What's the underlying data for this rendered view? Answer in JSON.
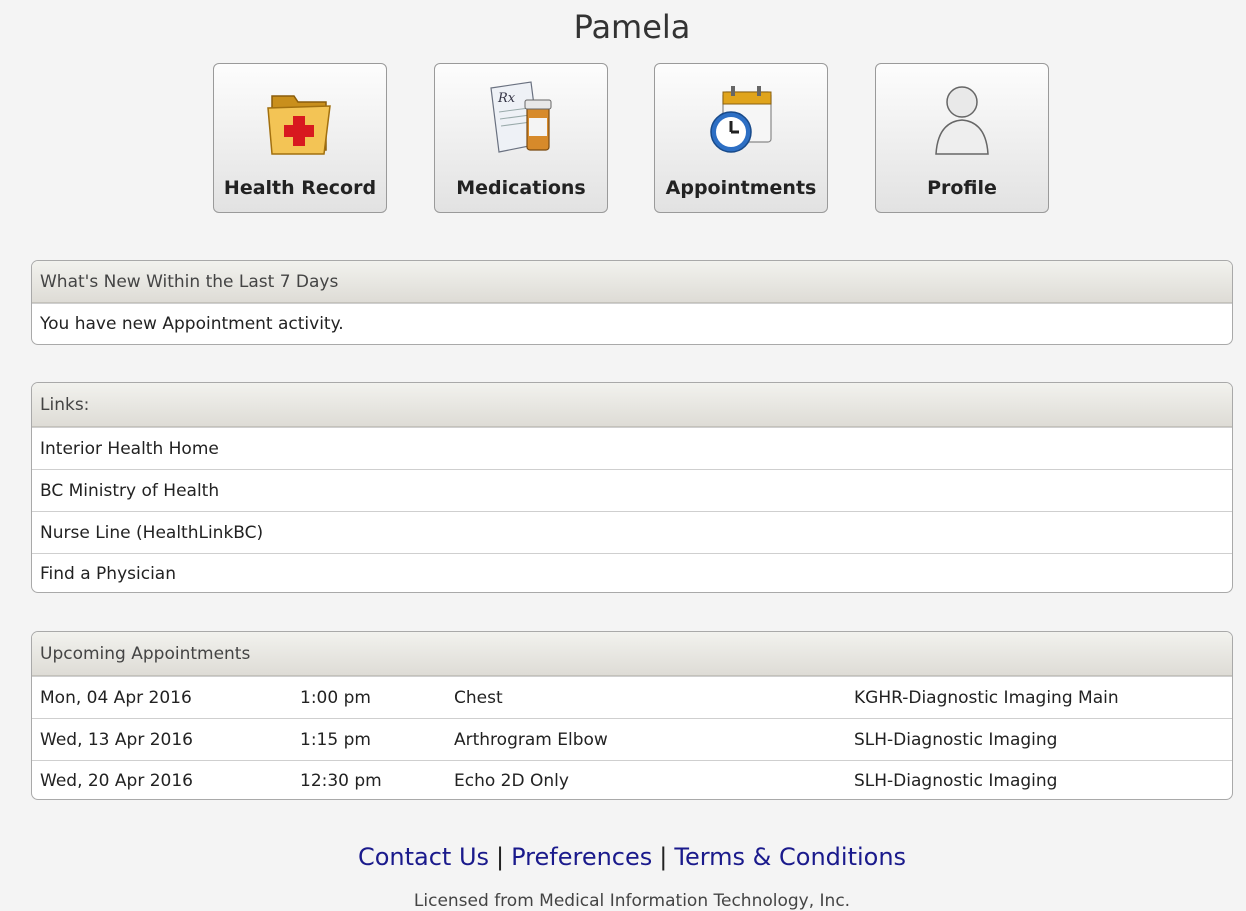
{
  "header": {
    "title": "Pamela"
  },
  "tiles": [
    {
      "label": "Health Record",
      "icon": "health-record-folder-icon"
    },
    {
      "label": "Medications",
      "icon": "medications-rx-icon"
    },
    {
      "label": "Appointments",
      "icon": "appointments-calendar-clock-icon"
    },
    {
      "label": "Profile",
      "icon": "profile-person-icon"
    }
  ],
  "whats_new": {
    "header": "What's New Within the Last 7 Days",
    "message": "You have new Appointment activity."
  },
  "links": {
    "header": "Links:",
    "items": [
      "Interior Health Home",
      "BC Ministry of Health",
      "Nurse Line (HealthLinkBC)",
      "Find a Physician"
    ]
  },
  "appointments": {
    "header": "Upcoming Appointments",
    "rows": [
      {
        "date": "Mon, 04 Apr 2016",
        "time": "1:00 pm",
        "exam": "Chest",
        "location": "KGHR-Diagnostic Imaging Main"
      },
      {
        "date": "Wed, 13 Apr 2016",
        "time": "1:15 pm",
        "exam": "Arthrogram Elbow",
        "location": "SLH-Diagnostic Imaging"
      },
      {
        "date": "Wed, 20 Apr 2016",
        "time": "12:30 pm",
        "exam": "Echo 2D Only",
        "location": "SLH-Diagnostic Imaging"
      }
    ]
  },
  "footer": {
    "contact": "Contact Us",
    "preferences": "Preferences",
    "terms": "Terms & Conditions",
    "separator": "|",
    "license": "Licensed from Medical Information Technology, Inc."
  },
  "colors": {
    "link": "#1a1a8c",
    "panel_header": "#e6e4de",
    "background": "#f4f4f4"
  }
}
